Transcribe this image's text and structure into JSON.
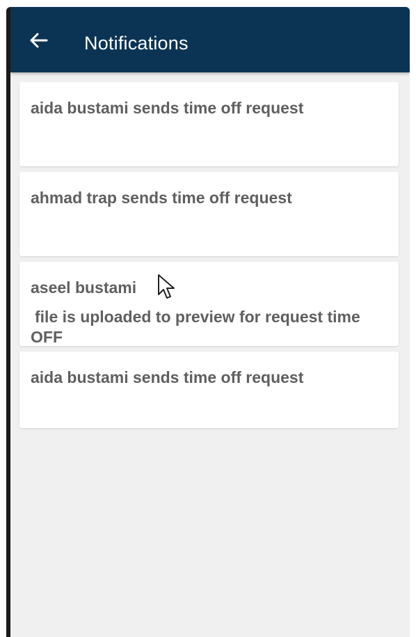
{
  "appbar": {
    "back_icon": "arrow-left-icon",
    "title": "Notifications",
    "background": "#0b3454"
  },
  "notifications": [
    {
      "text": "aida bustami sends time off request"
    },
    {
      "text": "ahmad trap sends time off request"
    },
    {
      "name": "aseel bustami",
      "line2": "file is uploaded to preview for request time",
      "line3": "OFF"
    },
    {
      "text": "aida bustami sends time off request"
    }
  ],
  "cursor_icon": "mouse-pointer-icon"
}
